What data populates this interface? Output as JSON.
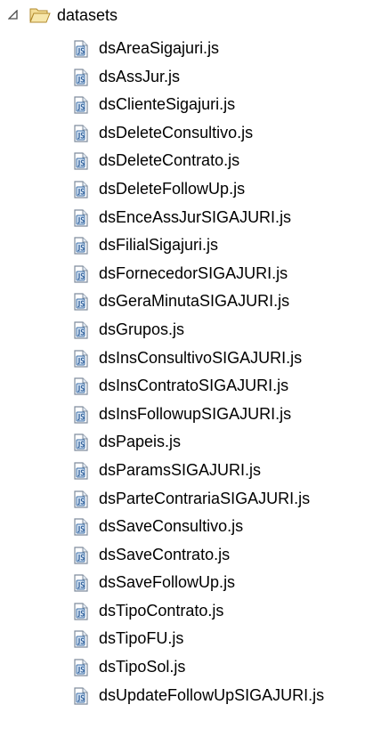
{
  "tree": {
    "folder": {
      "label": "datasets",
      "toggle_icon": "expanded-triangle-icon",
      "icon": "open-folder-icon",
      "folder_color": "#e8c873"
    },
    "file_icon": "javascript-file-icon",
    "files": [
      "dsAreaSigajuri.js",
      "dsAssJur.js",
      "dsClienteSigajuri.js",
      "dsDeleteConsultivo.js",
      "dsDeleteContrato.js",
      "dsDeleteFollowUp.js",
      "dsEnceAssJurSIGAJURI.js",
      "dsFilialSigajuri.js",
      "dsFornecedorSIGAJURI.js",
      "dsGeraMinutaSIGAJURI.js",
      "dsGrupos.js",
      "dsInsConsultivoSIGAJURI.js",
      "dsInsContratoSIGAJURI.js",
      "dsInsFollowupSIGAJURI.js",
      "dsPapeis.js",
      "dsParamsSIGAJURI.js",
      "dsParteContrariaSIGAJURI.js",
      "dsSaveConsultivo.js",
      "dsSaveContrato.js",
      "dsSaveFollowUp.js",
      "dsTipoContrato.js",
      "dsTipoFU.js",
      "dsTipoSol.js",
      "dsUpdateFollowUpSIGAJURI.js"
    ]
  }
}
